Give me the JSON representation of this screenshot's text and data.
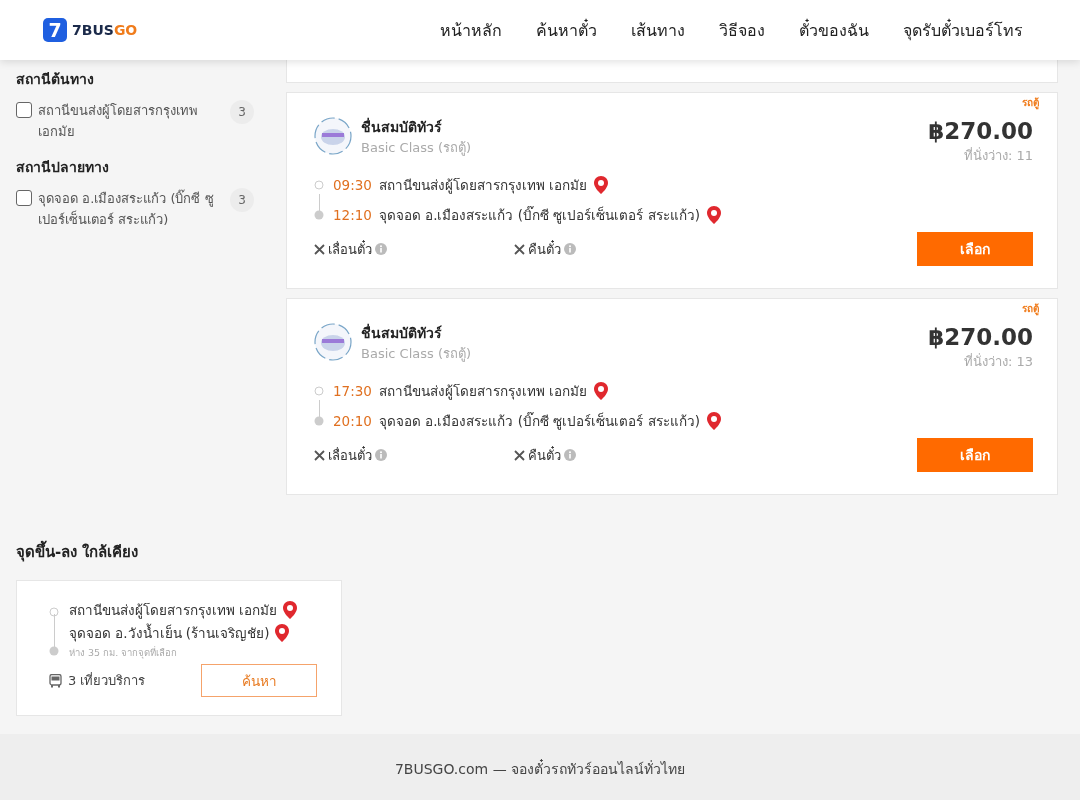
{
  "header": {
    "logo": {
      "mark": "7",
      "name_part_1": "7BUS",
      "name_part_2": "GO"
    },
    "nav": [
      {
        "label": "หน้าหลัก"
      },
      {
        "label": "ค้นหาตั๋ว"
      },
      {
        "label": "เส้นทาง"
      },
      {
        "label": "วิธีจอง"
      },
      {
        "label": "ตั๋วของฉัน"
      },
      {
        "label": "จุดรับตั๋วเบอร์โทร"
      }
    ]
  },
  "filters": [
    {
      "title": "สถานีต้นทาง",
      "options": [
        {
          "label": "สถานีขนส่งผู้โดยสารกรุงเทพ เอกมัย",
          "count": "3",
          "checked": false
        }
      ]
    },
    {
      "title": "สถานีปลายทาง",
      "options": [
        {
          "label": "จุดจอด อ.เมืองสระแก้ว (บิ๊กซี ซูเปอร์เซ็นเตอร์ สระแก้ว)",
          "count": "3",
          "checked": false
        }
      ]
    }
  ],
  "trips": [
    {
      "badge": "รถตู้",
      "operator": "ชื่นสมบัติทัวร์",
      "class": "Basic Class (รถตู้)",
      "price": "฿270.00",
      "seats": "ที่นั่งว่าง: 11",
      "stops": [
        {
          "kind": "origin",
          "time": "09:30",
          "name": "สถานีขนส่งผู้โดยสารกรุงเทพ เอกมัย"
        },
        {
          "kind": "destination",
          "time": "12:10",
          "name": "จุดจอด อ.เมืองสระแก้ว (บิ๊กซี ซูเปอร์เซ็นเตอร์ สระแก้ว)"
        }
      ],
      "policies": [
        {
          "label": "เลื่อนตั๋ว",
          "allowed": false
        },
        {
          "label": "คืนตั๋ว",
          "allowed": false
        }
      ],
      "button": "เลือก"
    },
    {
      "badge": "รถตู้",
      "operator": "ชื่นสมบัติทัวร์",
      "class": "Basic Class (รถตู้)",
      "price": "฿270.00",
      "seats": "ที่นั่งว่าง: 13",
      "stops": [
        {
          "kind": "origin",
          "time": "17:30",
          "name": "สถานีขนส่งผู้โดยสารกรุงเทพ เอกมัย"
        },
        {
          "kind": "destination",
          "time": "20:10",
          "name": "จุดจอด อ.เมืองสระแก้ว (บิ๊กซี ซูเปอร์เซ็นเตอร์ สระแก้ว)"
        }
      ],
      "policies": [
        {
          "label": "เลื่อนตั๋ว",
          "allowed": false
        },
        {
          "label": "คืนตั๋ว",
          "allowed": false
        }
      ],
      "button": "เลือก"
    }
  ],
  "nearby": {
    "title": "จุดขึ้น-ลง ใกล้เคียง",
    "routes": [
      {
        "stops": [
          {
            "kind": "origin",
            "name": "สถานีขนส่งผู้โดยสารกรุงเทพ เอกมัย"
          },
          {
            "kind": "destination",
            "name": "จุดจอด อ.วังน้ำเย็น (ร้านเจริญชัย)",
            "note": "ห่าง 35 กม. จากจุดที่เลือก"
          }
        ],
        "trips": "3 เที่ยวบริการ",
        "button": "ค้นหา"
      }
    ]
  },
  "footer": {
    "text": "7BUSGO.com — จองตั๋วรถทัวร์ออนไลน์ทั่วไทย"
  }
}
